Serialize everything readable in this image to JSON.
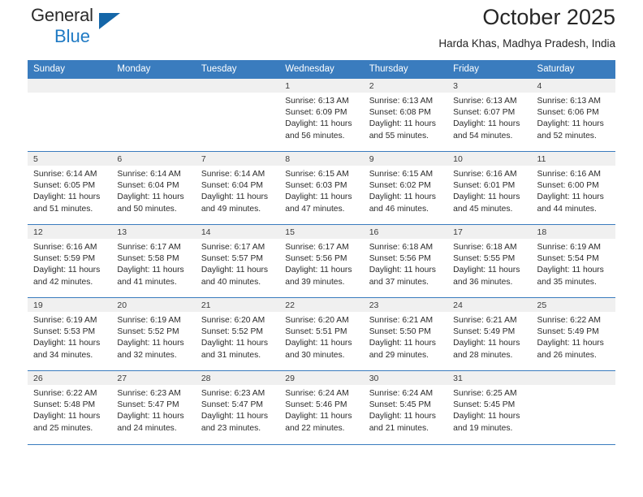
{
  "brand": {
    "name_line1": "General",
    "name_line2": "Blue",
    "triangle_color": "#1466a8",
    "accent_color": "#1f7ac4"
  },
  "header": {
    "title": "October 2025",
    "location": "Harda Khas, Madhya Pradesh, India"
  },
  "theme": {
    "header_row_bg": "#3a7cbe",
    "daynum_bg": "#f0f0f0",
    "grid_line": "#3a7cbe",
    "text": "#2b2b2b"
  },
  "weekdays": [
    "Sunday",
    "Monday",
    "Tuesday",
    "Wednesday",
    "Thursday",
    "Friday",
    "Saturday"
  ],
  "weeks": [
    [
      {
        "day": "",
        "empty": true,
        "sunrise": "",
        "sunset": "",
        "daylight1": "",
        "daylight2": ""
      },
      {
        "day": "",
        "empty": true,
        "sunrise": "",
        "sunset": "",
        "daylight1": "",
        "daylight2": ""
      },
      {
        "day": "",
        "empty": true,
        "sunrise": "",
        "sunset": "",
        "daylight1": "",
        "daylight2": ""
      },
      {
        "day": "1",
        "empty": false,
        "sunrise": "Sunrise: 6:13 AM",
        "sunset": "Sunset: 6:09 PM",
        "daylight1": "Daylight: 11 hours",
        "daylight2": "and 56 minutes."
      },
      {
        "day": "2",
        "empty": false,
        "sunrise": "Sunrise: 6:13 AM",
        "sunset": "Sunset: 6:08 PM",
        "daylight1": "Daylight: 11 hours",
        "daylight2": "and 55 minutes."
      },
      {
        "day": "3",
        "empty": false,
        "sunrise": "Sunrise: 6:13 AM",
        "sunset": "Sunset: 6:07 PM",
        "daylight1": "Daylight: 11 hours",
        "daylight2": "and 54 minutes."
      },
      {
        "day": "4",
        "empty": false,
        "sunrise": "Sunrise: 6:13 AM",
        "sunset": "Sunset: 6:06 PM",
        "daylight1": "Daylight: 11 hours",
        "daylight2": "and 52 minutes."
      }
    ],
    [
      {
        "day": "5",
        "empty": false,
        "sunrise": "Sunrise: 6:14 AM",
        "sunset": "Sunset: 6:05 PM",
        "daylight1": "Daylight: 11 hours",
        "daylight2": "and 51 minutes."
      },
      {
        "day": "6",
        "empty": false,
        "sunrise": "Sunrise: 6:14 AM",
        "sunset": "Sunset: 6:04 PM",
        "daylight1": "Daylight: 11 hours",
        "daylight2": "and 50 minutes."
      },
      {
        "day": "7",
        "empty": false,
        "sunrise": "Sunrise: 6:14 AM",
        "sunset": "Sunset: 6:04 PM",
        "daylight1": "Daylight: 11 hours",
        "daylight2": "and 49 minutes."
      },
      {
        "day": "8",
        "empty": false,
        "sunrise": "Sunrise: 6:15 AM",
        "sunset": "Sunset: 6:03 PM",
        "daylight1": "Daylight: 11 hours",
        "daylight2": "and 47 minutes."
      },
      {
        "day": "9",
        "empty": false,
        "sunrise": "Sunrise: 6:15 AM",
        "sunset": "Sunset: 6:02 PM",
        "daylight1": "Daylight: 11 hours",
        "daylight2": "and 46 minutes."
      },
      {
        "day": "10",
        "empty": false,
        "sunrise": "Sunrise: 6:16 AM",
        "sunset": "Sunset: 6:01 PM",
        "daylight1": "Daylight: 11 hours",
        "daylight2": "and 45 minutes."
      },
      {
        "day": "11",
        "empty": false,
        "sunrise": "Sunrise: 6:16 AM",
        "sunset": "Sunset: 6:00 PM",
        "daylight1": "Daylight: 11 hours",
        "daylight2": "and 44 minutes."
      }
    ],
    [
      {
        "day": "12",
        "empty": false,
        "sunrise": "Sunrise: 6:16 AM",
        "sunset": "Sunset: 5:59 PM",
        "daylight1": "Daylight: 11 hours",
        "daylight2": "and 42 minutes."
      },
      {
        "day": "13",
        "empty": false,
        "sunrise": "Sunrise: 6:17 AM",
        "sunset": "Sunset: 5:58 PM",
        "daylight1": "Daylight: 11 hours",
        "daylight2": "and 41 minutes."
      },
      {
        "day": "14",
        "empty": false,
        "sunrise": "Sunrise: 6:17 AM",
        "sunset": "Sunset: 5:57 PM",
        "daylight1": "Daylight: 11 hours",
        "daylight2": "and 40 minutes."
      },
      {
        "day": "15",
        "empty": false,
        "sunrise": "Sunrise: 6:17 AM",
        "sunset": "Sunset: 5:56 PM",
        "daylight1": "Daylight: 11 hours",
        "daylight2": "and 39 minutes."
      },
      {
        "day": "16",
        "empty": false,
        "sunrise": "Sunrise: 6:18 AM",
        "sunset": "Sunset: 5:56 PM",
        "daylight1": "Daylight: 11 hours",
        "daylight2": "and 37 minutes."
      },
      {
        "day": "17",
        "empty": false,
        "sunrise": "Sunrise: 6:18 AM",
        "sunset": "Sunset: 5:55 PM",
        "daylight1": "Daylight: 11 hours",
        "daylight2": "and 36 minutes."
      },
      {
        "day": "18",
        "empty": false,
        "sunrise": "Sunrise: 6:19 AM",
        "sunset": "Sunset: 5:54 PM",
        "daylight1": "Daylight: 11 hours",
        "daylight2": "and 35 minutes."
      }
    ],
    [
      {
        "day": "19",
        "empty": false,
        "sunrise": "Sunrise: 6:19 AM",
        "sunset": "Sunset: 5:53 PM",
        "daylight1": "Daylight: 11 hours",
        "daylight2": "and 34 minutes."
      },
      {
        "day": "20",
        "empty": false,
        "sunrise": "Sunrise: 6:19 AM",
        "sunset": "Sunset: 5:52 PM",
        "daylight1": "Daylight: 11 hours",
        "daylight2": "and 32 minutes."
      },
      {
        "day": "21",
        "empty": false,
        "sunrise": "Sunrise: 6:20 AM",
        "sunset": "Sunset: 5:52 PM",
        "daylight1": "Daylight: 11 hours",
        "daylight2": "and 31 minutes."
      },
      {
        "day": "22",
        "empty": false,
        "sunrise": "Sunrise: 6:20 AM",
        "sunset": "Sunset: 5:51 PM",
        "daylight1": "Daylight: 11 hours",
        "daylight2": "and 30 minutes."
      },
      {
        "day": "23",
        "empty": false,
        "sunrise": "Sunrise: 6:21 AM",
        "sunset": "Sunset: 5:50 PM",
        "daylight1": "Daylight: 11 hours",
        "daylight2": "and 29 minutes."
      },
      {
        "day": "24",
        "empty": false,
        "sunrise": "Sunrise: 6:21 AM",
        "sunset": "Sunset: 5:49 PM",
        "daylight1": "Daylight: 11 hours",
        "daylight2": "and 28 minutes."
      },
      {
        "day": "25",
        "empty": false,
        "sunrise": "Sunrise: 6:22 AM",
        "sunset": "Sunset: 5:49 PM",
        "daylight1": "Daylight: 11 hours",
        "daylight2": "and 26 minutes."
      }
    ],
    [
      {
        "day": "26",
        "empty": false,
        "sunrise": "Sunrise: 6:22 AM",
        "sunset": "Sunset: 5:48 PM",
        "daylight1": "Daylight: 11 hours",
        "daylight2": "and 25 minutes."
      },
      {
        "day": "27",
        "empty": false,
        "sunrise": "Sunrise: 6:23 AM",
        "sunset": "Sunset: 5:47 PM",
        "daylight1": "Daylight: 11 hours",
        "daylight2": "and 24 minutes."
      },
      {
        "day": "28",
        "empty": false,
        "sunrise": "Sunrise: 6:23 AM",
        "sunset": "Sunset: 5:47 PM",
        "daylight1": "Daylight: 11 hours",
        "daylight2": "and 23 minutes."
      },
      {
        "day": "29",
        "empty": false,
        "sunrise": "Sunrise: 6:24 AM",
        "sunset": "Sunset: 5:46 PM",
        "daylight1": "Daylight: 11 hours",
        "daylight2": "and 22 minutes."
      },
      {
        "day": "30",
        "empty": false,
        "sunrise": "Sunrise: 6:24 AM",
        "sunset": "Sunset: 5:45 PM",
        "daylight1": "Daylight: 11 hours",
        "daylight2": "and 21 minutes."
      },
      {
        "day": "31",
        "empty": false,
        "sunrise": "Sunrise: 6:25 AM",
        "sunset": "Sunset: 5:45 PM",
        "daylight1": "Daylight: 11 hours",
        "daylight2": "and 19 minutes."
      },
      {
        "day": "",
        "empty": true,
        "sunrise": "",
        "sunset": "",
        "daylight1": "",
        "daylight2": ""
      }
    ]
  ]
}
